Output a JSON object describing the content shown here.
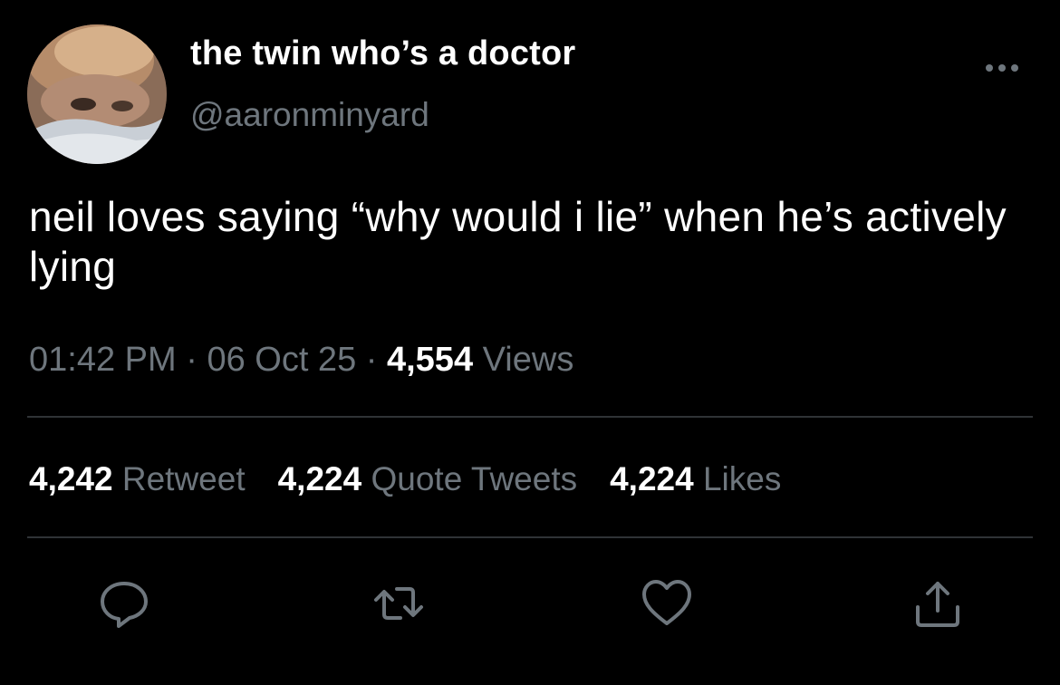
{
  "author": {
    "display_name": "the twin who’s a doctor",
    "handle": "@aaronminyard"
  },
  "tweet": {
    "text": "neil loves saying “why would i lie” when he’s actively lying"
  },
  "meta": {
    "time": "01:42 PM",
    "separator": " · ",
    "date": "06 Oct 25",
    "views_count": "4,554",
    "views_label": " Views"
  },
  "stats": {
    "retweets_count": "4,242",
    "retweets_label": " Retweet",
    "quotes_count": "4,224",
    "quotes_label": " Quote Tweets",
    "likes_count": "4,224",
    "likes_label": " Likes"
  },
  "actions": {
    "reply_icon": "reply-icon",
    "retweet_icon": "retweet-icon",
    "like_icon": "heart-icon",
    "share_icon": "share-icon"
  },
  "colors": {
    "background": "#000000",
    "text_primary": "#ffffff",
    "text_secondary": "#6e767d",
    "divider": "#2f3336"
  }
}
